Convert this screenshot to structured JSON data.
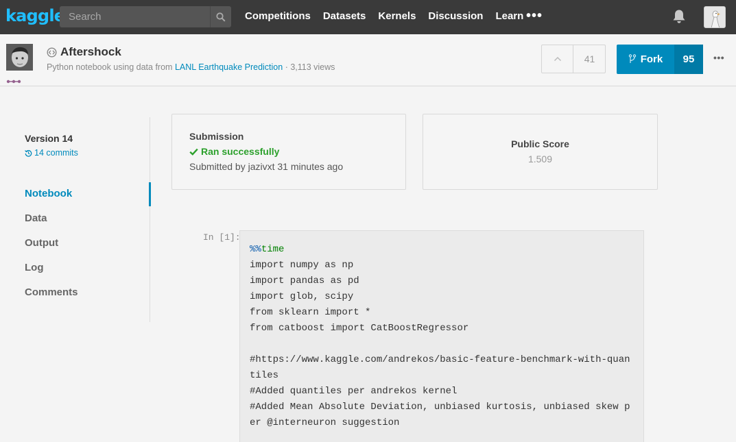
{
  "nav": {
    "logo": "kaggle",
    "search_placeholder": "Search",
    "links": [
      "Competitions",
      "Datasets",
      "Kernels",
      "Discussion",
      "Learn"
    ],
    "more": "•••",
    "icons": [
      "search-icon",
      "bell-icon",
      "user-avatar"
    ]
  },
  "kernel": {
    "title": "Aftershock",
    "subtitle_prefix": "Python notebook using data from ",
    "dataset_link": "LANL Earthquake Prediction",
    "subtitle_suffix": " · 3,113 views",
    "votes": "41",
    "fork_label": "Fork",
    "fork_count": "95",
    "more": "•••"
  },
  "sidebar": {
    "version": "Version 14",
    "commits": "14 commits",
    "items": [
      {
        "label": "Notebook",
        "active": true
      },
      {
        "label": "Data",
        "active": false
      },
      {
        "label": "Output",
        "active": false
      },
      {
        "label": "Log",
        "active": false
      },
      {
        "label": "Comments",
        "active": false
      }
    ]
  },
  "submission": {
    "heading": "Submission",
    "status": "Ran successfully",
    "submitted_by": "Submitted by jazivxt 31 minutes ago"
  },
  "score": {
    "label": "Public Score",
    "value": "1.509"
  },
  "cell": {
    "prompt": "In [1]:",
    "magic_prefix": "%%",
    "magic_name": "time",
    "code": "import numpy as np\nimport pandas as pd\nimport glob, scipy\nfrom sklearn import *\nfrom catboost import CatBoostRegressor\n\n#https://www.kaggle.com/andrekos/basic-feature-benchmark-with-quan\ntiles\n#Added quantiles per andrekos kernel\n#Added Mean Absolute Deviation, unbiased kurtosis, unbiased skew p\ner @interneuron suggestion"
  },
  "colors": {
    "accent": "#008abc",
    "logo": "#20beff",
    "success": "#2ca02c",
    "topbar": "#3a3a3a"
  }
}
